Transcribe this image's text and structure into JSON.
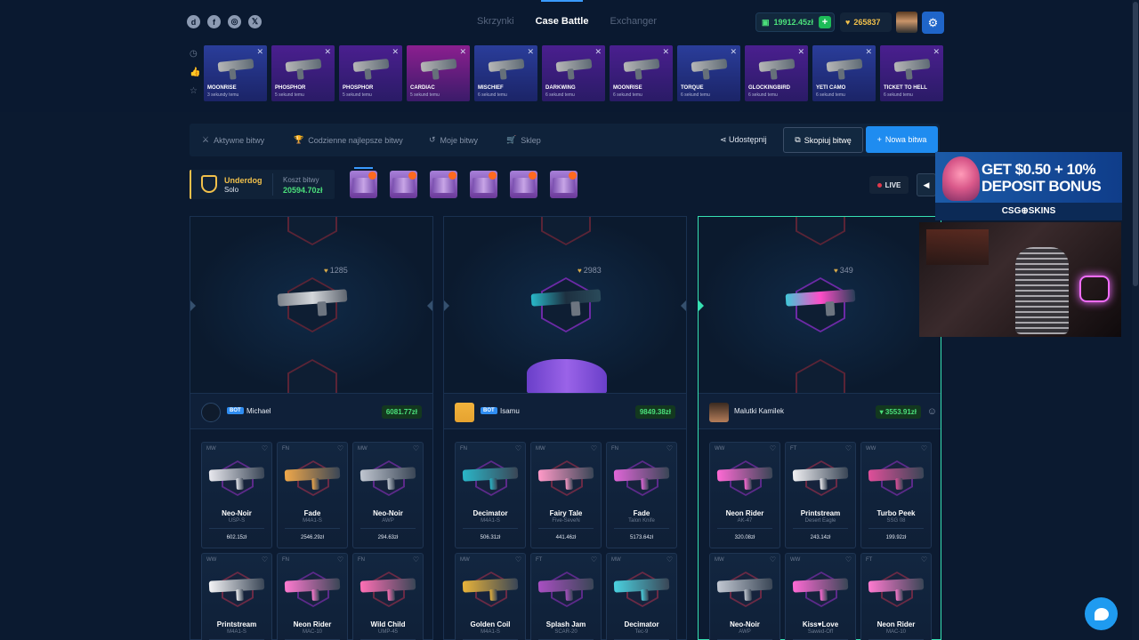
{
  "header": {
    "social": [
      "Discord",
      "Facebook",
      "Instagram",
      "X"
    ],
    "nav": [
      {
        "label": "Skrzynki",
        "active": false
      },
      {
        "label": "Case Battle",
        "active": true
      },
      {
        "label": "Exchanger",
        "active": false
      }
    ],
    "balance": "19912.45zł",
    "coins": "265837"
  },
  "live_drops": [
    {
      "name": "MOONRISE",
      "sub": "3 sekundy temu",
      "tone": "blue"
    },
    {
      "name": "PHOSPHOR",
      "sub": "5 sekund temu",
      "tone": "purple"
    },
    {
      "name": "PHOSPHOR",
      "sub": "5 sekund temu",
      "tone": "purple"
    },
    {
      "name": "CARDIAC",
      "sub": "5 sekund temu",
      "tone": "pink"
    },
    {
      "name": "MISCHIEF",
      "sub": "6 sekund temu",
      "tone": "blue"
    },
    {
      "name": "DARKWING",
      "sub": "6 sekund temu",
      "tone": "purple"
    },
    {
      "name": "MOONRISE",
      "sub": "6 sekund temu",
      "tone": "purple"
    },
    {
      "name": "TORQUE",
      "sub": "6 sekund temu",
      "tone": "blue"
    },
    {
      "name": "GLOCKINGBIRD",
      "sub": "6 sekund temu",
      "tone": "purple"
    },
    {
      "name": "YETI CAMO",
      "sub": "6 sekund temu",
      "tone": "blue"
    },
    {
      "name": "TICKET TO HELL",
      "sub": "6 sekund temu",
      "tone": "purple"
    }
  ],
  "toolbar": {
    "tabs": [
      "Aktywne bitwy",
      "Codzienne najlepsze bitwy",
      "Moje bitwy",
      "Sklep"
    ],
    "share": "Udostępnij",
    "copy": "Skopiuj bitwę",
    "new": "Nowa bitwa"
  },
  "battle": {
    "mode": "Underdog",
    "type": "Solo",
    "cost_label": "Koszt bitwy",
    "cost": "20594.70zł",
    "live": "LIVE",
    "case_count": 6
  },
  "columns": [
    {
      "reel_value": "1285",
      "player": "Michael",
      "bot": "BOT",
      "total": "6081.77zł",
      "items": [
        {
          "cond": "MW",
          "name": "Neo-Noir",
          "weapon": "USP-S",
          "price": "602.15zł",
          "color": "#e8e8ee"
        },
        {
          "cond": "FN",
          "name": "Fade",
          "weapon": "M4A1-S",
          "price": "2546.29zł",
          "color": "#f0a84a"
        },
        {
          "cond": "MW",
          "name": "Neo-Noir",
          "weapon": "AWP",
          "price": "294.63zł",
          "color": "#c0c6d0"
        },
        {
          "cond": "WW",
          "name": "Printstream",
          "weapon": "M4A1-S",
          "price": "",
          "color": "#f4f4f6"
        },
        {
          "cond": "FN",
          "name": "Neon Rider",
          "weapon": "MAC-10",
          "price": "",
          "color": "#ff7ad0"
        },
        {
          "cond": "FN",
          "name": "Wild Child",
          "weapon": "UMP-45",
          "price": "",
          "color": "#ff6fb5"
        }
      ]
    },
    {
      "reel_value": "2983",
      "player": "Isamu",
      "bot": "BOT",
      "total": "9849.38zł",
      "items": [
        {
          "cond": "FN",
          "name": "Decimator",
          "weapon": "M4A1-S",
          "price": "506.31zł",
          "color": "#2ab6c8"
        },
        {
          "cond": "MW",
          "name": "Fairy Tale",
          "weapon": "Five-SeveN",
          "price": "441.46zł",
          "color": "#ff9ac8"
        },
        {
          "cond": "FN",
          "name": "Fade",
          "weapon": "Talon Knife",
          "price": "5173.64zł",
          "color": "#e066d8"
        },
        {
          "cond": "MW",
          "name": "Golden Coil",
          "weapon": "M4A1-S",
          "price": "",
          "color": "#e8b33a"
        },
        {
          "cond": "FT",
          "name": "Splash Jam",
          "weapon": "SCAR-20",
          "price": "",
          "color": "#a94fc2"
        },
        {
          "cond": "MW",
          "name": "Decimator",
          "weapon": "Tec-9",
          "price": "",
          "color": "#4ad1e0"
        }
      ]
    },
    {
      "reel_value": "349",
      "player": "Malutki Kamilek",
      "bot": "",
      "total": "3553.91zł",
      "items": [
        {
          "cond": "WW",
          "name": "Neon Rider",
          "weapon": "AK-47",
          "price": "320.08zł",
          "color": "#ff6ad5"
        },
        {
          "cond": "FT",
          "name": "Printstream",
          "weapon": "Desert Eagle",
          "price": "243.14zł",
          "color": "#f0f0f3"
        },
        {
          "cond": "WW",
          "name": "Turbo Peek",
          "weapon": "SSG 08",
          "price": "199.92zł",
          "color": "#e04f9a"
        },
        {
          "cond": "MW",
          "name": "Neo-Noir",
          "weapon": "AWP",
          "price": "",
          "color": "#c2c8d2"
        },
        {
          "cond": "WW",
          "name": "Kiss♥Love",
          "weapon": "Sawed-Off",
          "price": "",
          "color": "#ff6ad5"
        },
        {
          "cond": "FT",
          "name": "Neon Rider",
          "weapon": "MAC-10",
          "price": "",
          "color": "#ff7ad0"
        }
      ]
    }
  ],
  "promo": {
    "line1": "GET $0.50 + 10%",
    "line2": "DEPOSIT BONUS",
    "brand": "CSG⊕SKINS"
  },
  "webcam": {
    "label": "webcam"
  }
}
